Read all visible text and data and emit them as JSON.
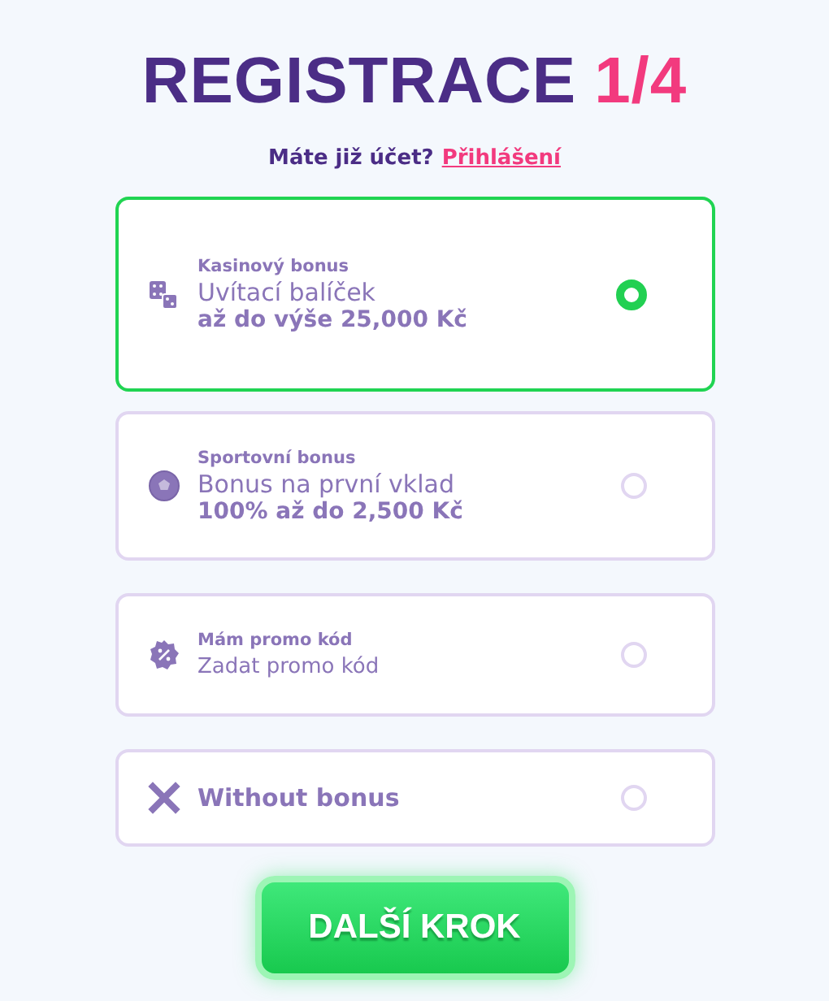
{
  "title": {
    "text": "REGISTRACE",
    "step": "1/4"
  },
  "login_prompt": {
    "text": "Máte již účet?",
    "link": "Přihlášení"
  },
  "options": [
    {
      "kind": "offer",
      "label": "Kasinový bonus",
      "title": "Uvítací balíček",
      "amount": "až do výše 25,000 Kč",
      "selected": true
    },
    {
      "kind": "offer",
      "label": "Sportovní bonus",
      "title": "Bonus na první vklad",
      "amount": "100% až do 2,500 Kč",
      "selected": false
    },
    {
      "kind": "promo",
      "label": "Mám promo kód",
      "placeholder": "Zadat promo kód",
      "selected": false
    },
    {
      "kind": "plain",
      "title": "Without bonus",
      "selected": false
    }
  ],
  "next_button": "DALŠÍ KROK"
}
